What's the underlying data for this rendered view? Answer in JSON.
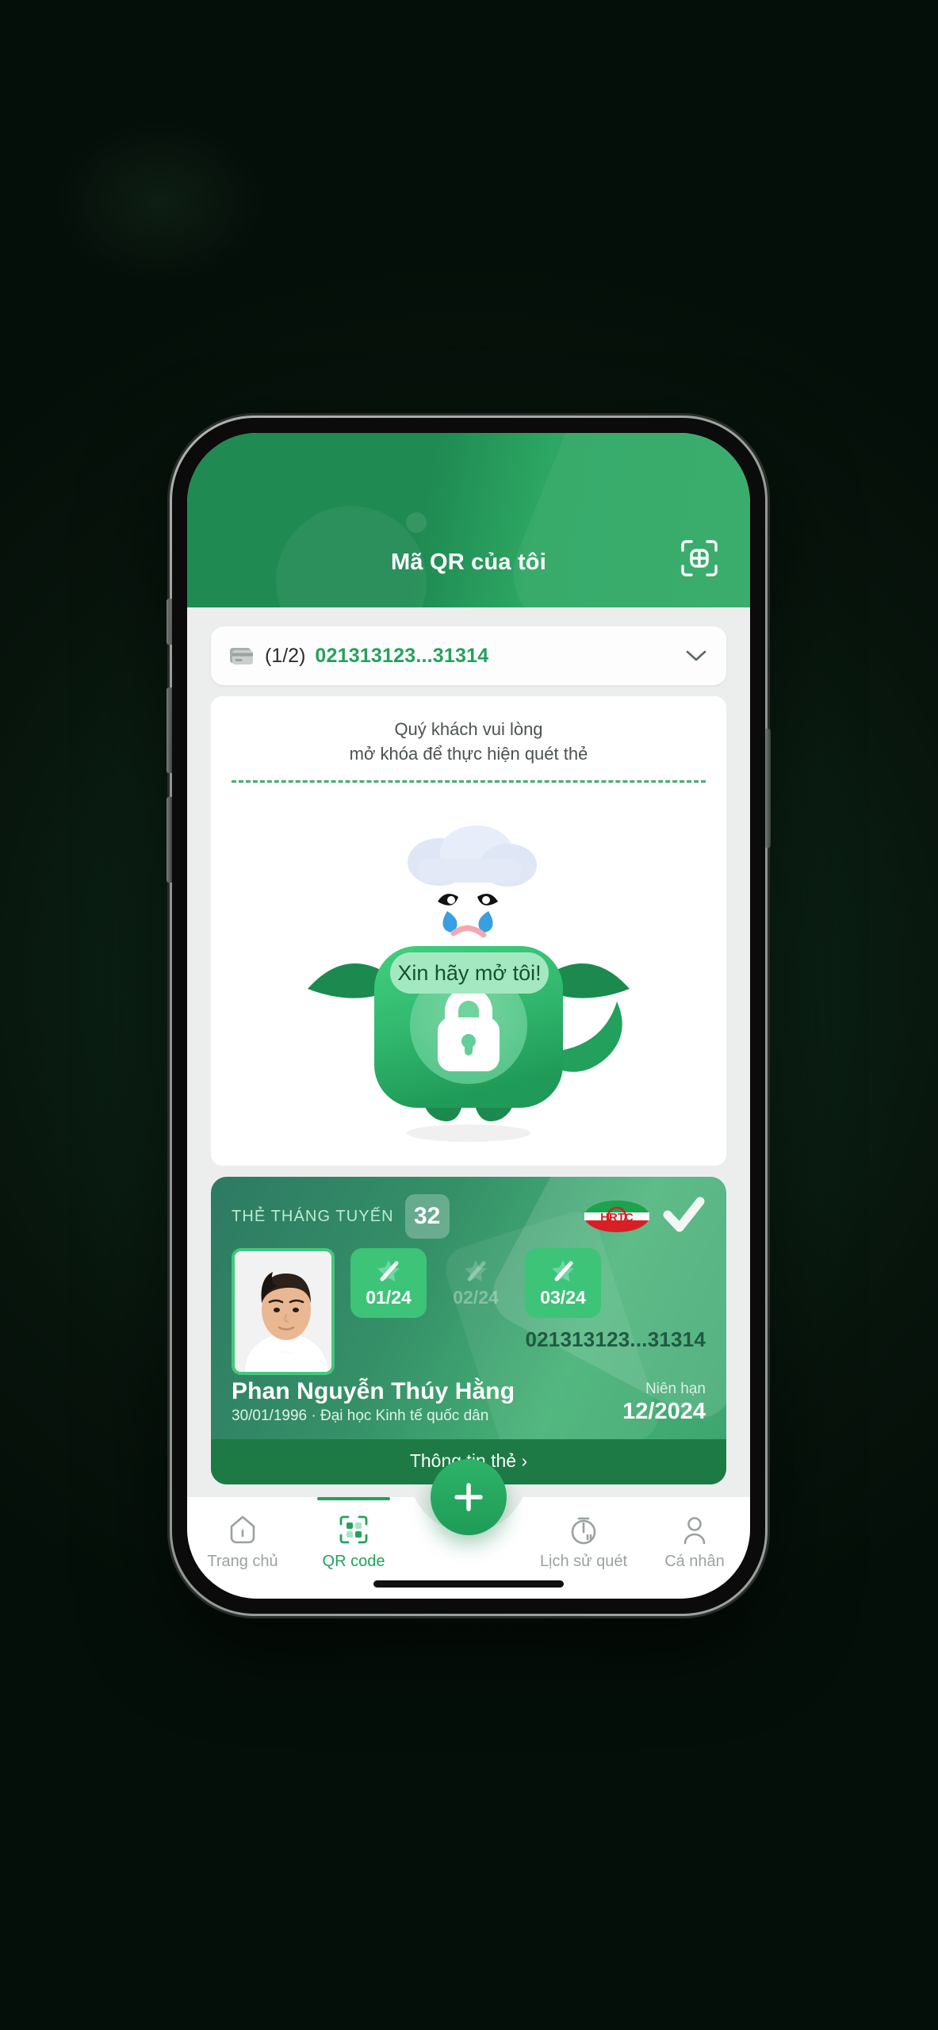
{
  "header": {
    "title": "Mã QR của tôi",
    "scan_icon": "scan-qr-icon"
  },
  "card_selector": {
    "card_icon": "credit-card-icon",
    "count": "(1/2)",
    "card_number": "021313123...31314",
    "chevron_icon": "chevron-down-icon"
  },
  "unlock_notice": {
    "line1": "Quý khách vui lòng",
    "line2": "mở khóa để thực hiện quét thẻ"
  },
  "mascot": {
    "speech_bubble": "Xin hãy mở tôi!",
    "lock_icon": "lock-icon",
    "cloud_icon": "rain-cloud-icon",
    "face": "crying-face"
  },
  "pass_card": {
    "tag": "THẺ THÁNG TUYẾN",
    "route_number": "32",
    "brand_logo": "hrtc-logo",
    "verified_icon": "check-mark-icon",
    "photo_alt": "cardholder-photo",
    "months": [
      {
        "label": "01/24",
        "active": true,
        "icon": "star-badge-icon"
      },
      {
        "label": "02/24",
        "active": false,
        "icon": "star-badge-icon"
      },
      {
        "label": "03/24",
        "active": true,
        "icon": "star-badge-icon"
      }
    ],
    "card_number": "021313123...31314",
    "holder_name": "Phan Nguyễn Thúy Hằng",
    "holder_sub": "30/01/1996 · Đại học Kinh tế quốc dân",
    "expiry_label": "Niên hạn",
    "expiry_value": "12/2024",
    "footer_label": "Thông tin thẻ",
    "footer_chevron": "chevron-right-icon"
  },
  "bottom_nav": {
    "fab_icon": "plus-icon",
    "items": [
      {
        "label": "Trang chủ",
        "icon": "home-icon",
        "active": false
      },
      {
        "label": "QR code",
        "icon": "qr-code-icon",
        "active": true
      },
      {
        "label": "Lịch sử quét",
        "icon": "timer-icon",
        "active": false
      },
      {
        "label": "Cá nhân",
        "icon": "person-icon",
        "active": false
      }
    ]
  },
  "colors": {
    "brand_green": "#24a15d",
    "header_green": "#1f8a52",
    "accent_light": "#3dc478",
    "card_footer": "#1d7a45",
    "background": "#0b1f13"
  }
}
